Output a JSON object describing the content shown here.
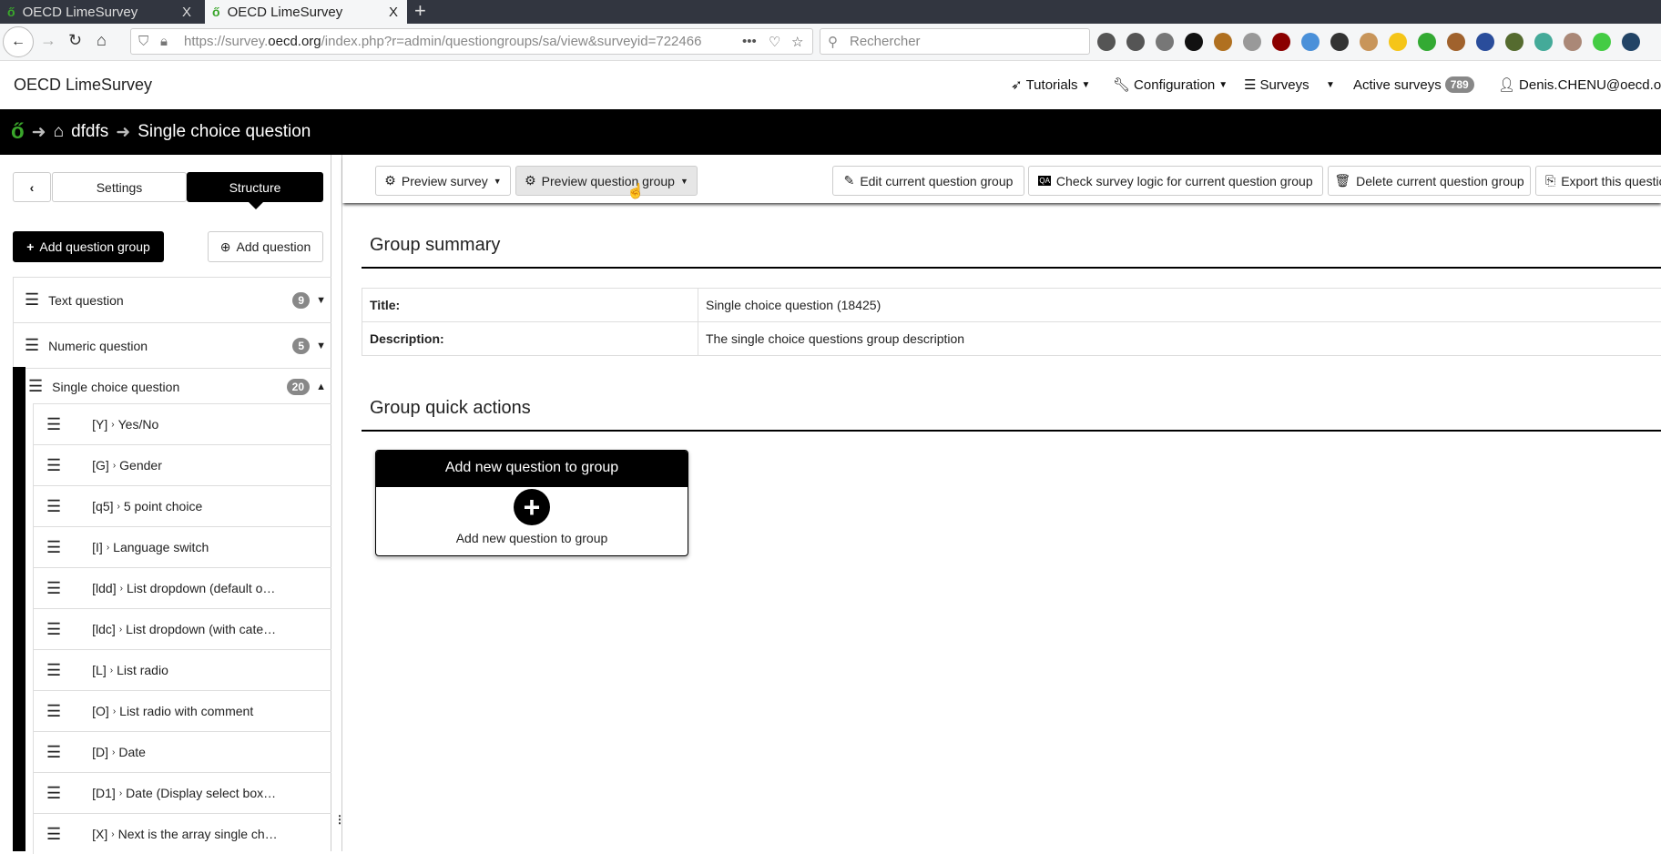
{
  "browser": {
    "tabs": [
      {
        "title": "OECD LimeSurvey",
        "close": "X"
      },
      {
        "title": "OECD LimeSurvey",
        "close": "X"
      }
    ],
    "new_tab": "+",
    "url_prefix": "https://survey.",
    "url_domain": "oecd.org",
    "url_rest": "/index.php?r=admin/questiongroups/sa/view&surveyid=722466",
    "url_more": "•••",
    "search_placeholder": "Rechercher",
    "extensions": [
      {
        "icon": "library-icon",
        "color": "#555"
      },
      {
        "icon": "sidebar-icon",
        "color": "#555"
      },
      {
        "icon": "face-icon",
        "color": "#777"
      },
      {
        "icon": "foot-icon",
        "color": "#111"
      },
      {
        "icon": "badger-icon",
        "color": "#b07020"
      },
      {
        "icon": "gear-ext-icon",
        "color": "#999"
      },
      {
        "icon": "ublock-icon",
        "color": "#8b0000"
      },
      {
        "icon": "diamond-icon",
        "color": "#4a90d9"
      },
      {
        "icon": "reader-icon",
        "color": "#333"
      },
      {
        "icon": "cookie-icon",
        "color": "#c8955a"
      },
      {
        "icon": "emoji-icon",
        "color": "#f5c518"
      },
      {
        "icon": "color-icon",
        "color": "#3a3"
      },
      {
        "icon": "monkey-icon",
        "color": "#a0622d"
      },
      {
        "icon": "shield-ext-icon",
        "color": "#2a4d9b"
      },
      {
        "icon": "globe-alert-icon",
        "color": "#556b2f"
      },
      {
        "icon": "s-icon",
        "color": "#4a9"
      },
      {
        "icon": "lf-icon",
        "color": "#a87"
      },
      {
        "icon": "js-icon",
        "color": "#4c4"
      },
      {
        "icon": "earth-icon",
        "color": "#246"
      }
    ]
  },
  "app": {
    "title": "OECD LimeSurvey",
    "nav": {
      "tutorials": "Tutorials",
      "configuration": "Configuration",
      "surveys": "Surveys",
      "active_surveys": "Active surveys",
      "active_count": "789",
      "user": "Denis.CHENU@oecd.org"
    }
  },
  "breadcrumb": {
    "survey": "dfdfs",
    "group": "Single choice question"
  },
  "sidebar": {
    "tabs": {
      "settings": "Settings",
      "structure": "Structure"
    },
    "add_group": "Add question group",
    "add_question": "Add question",
    "groups": [
      {
        "name": "Text question",
        "count": "9"
      },
      {
        "name": "Numeric question",
        "count": "5"
      },
      {
        "name": "Single choice question",
        "count": "20"
      }
    ],
    "questions": [
      {
        "code": "[Y]",
        "title": "Yes/No"
      },
      {
        "code": "[G]",
        "title": "Gender"
      },
      {
        "code": "[q5]",
        "title": "5 point choice"
      },
      {
        "code": "[I]",
        "title": "Language switch"
      },
      {
        "code": "[ldd]",
        "title": "List dropdown (default o…"
      },
      {
        "code": "[ldc]",
        "title": "List dropdown (with cate…"
      },
      {
        "code": "[L]",
        "title": "List radio"
      },
      {
        "code": "[O]",
        "title": "List radio with comment"
      },
      {
        "code": "[D]",
        "title": "Date"
      },
      {
        "code": "[D1]",
        "title": "Date (Display select box…"
      },
      {
        "code": "[X]",
        "title": "Next is the array single ch…"
      }
    ]
  },
  "toolbar": {
    "preview_survey": "Preview survey",
    "preview_group": "Preview question group",
    "edit": "Edit current question group",
    "check": "Check survey logic for current question group",
    "delete": "Delete current question group",
    "export": "Export this question group"
  },
  "summary": {
    "heading": "Group summary",
    "title_label": "Title:",
    "title_value": "Single choice question (18425)",
    "desc_label": "Description:",
    "desc_value": "The single choice questions group description"
  },
  "quick": {
    "heading": "Group quick actions",
    "card_title": "Add new question to group",
    "card_text": "Add new question to group"
  }
}
